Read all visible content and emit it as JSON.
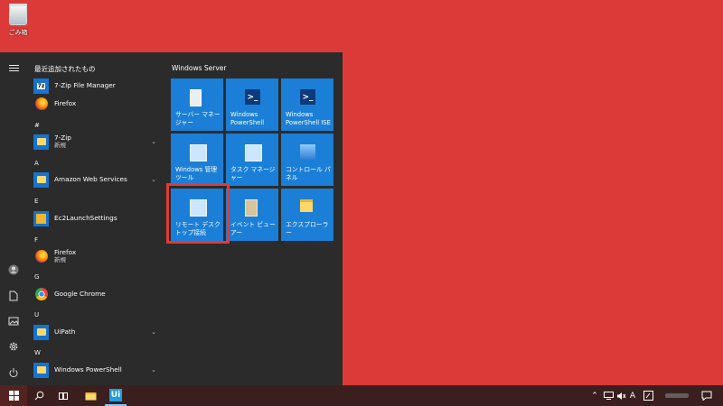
{
  "desktop": {
    "recycle_bin_label": "ごみ箱"
  },
  "start_menu": {
    "recent_title": "最近追加されたもの",
    "apps": [
      {
        "name": "7-Zip File Manager",
        "icon": "7zip-icon"
      },
      {
        "name": "Firefox",
        "icon": "firefox-icon"
      },
      {
        "header": "#"
      },
      {
        "name": "7-Zip",
        "sub": "新規",
        "icon": "folder-icon",
        "expandable": true
      },
      {
        "header": "A"
      },
      {
        "name": "Amazon Web Services",
        "icon": "folder-icon",
        "expandable": true
      },
      {
        "header": "E"
      },
      {
        "name": "Ec2LaunchSettings",
        "icon": "ec2-icon"
      },
      {
        "header": "F"
      },
      {
        "name": "Firefox",
        "sub": "新規",
        "icon": "firefox-icon"
      },
      {
        "header": "G"
      },
      {
        "name": "Google Chrome",
        "icon": "chrome-icon"
      },
      {
        "header": "U"
      },
      {
        "name": "UiPath",
        "icon": "folder-icon",
        "expandable": true
      },
      {
        "header": "W"
      },
      {
        "name": "Windows PowerShell",
        "icon": "folder-icon",
        "expandable": true
      }
    ],
    "tile_group_title": "Windows Server",
    "tiles": [
      {
        "label": "サーバー マネージャー",
        "icon": "server-manager-icon"
      },
      {
        "label": "Windows PowerShell",
        "icon": "powershell-icon"
      },
      {
        "label": "Windows PowerShell ISE",
        "icon": "powershell-ise-icon"
      },
      {
        "label": "Windows 管理ツール",
        "icon": "admin-tools-icon"
      },
      {
        "label": "タスク マネージャー",
        "icon": "task-manager-icon"
      },
      {
        "label": "コントロール パネル",
        "icon": "control-panel-icon"
      },
      {
        "label": "リモート デスクトップ接続",
        "icon": "remote-desktop-icon"
      },
      {
        "label": "イベント ビューアー",
        "icon": "event-viewer-icon"
      },
      {
        "label": "エクスプローラー",
        "icon": "explorer-icon"
      }
    ]
  },
  "taskbar": {
    "ime_mode": "A",
    "colors": {
      "desktop": "#dc3a38",
      "tile": "#1b7fd8",
      "highlight": "#e53935"
    }
  }
}
